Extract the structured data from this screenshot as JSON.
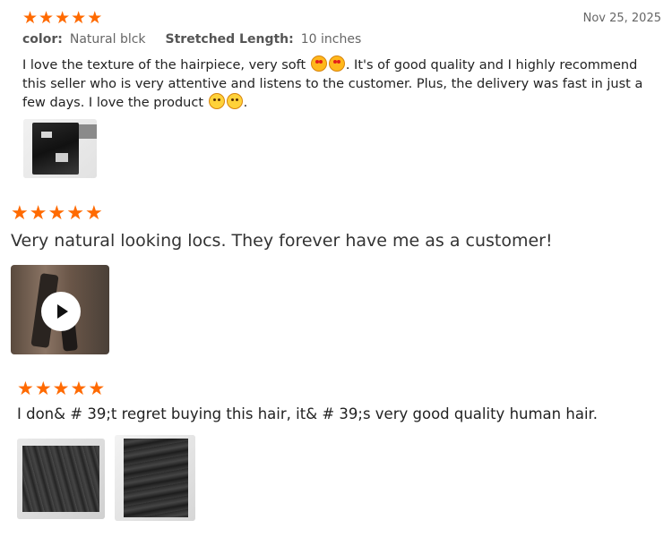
{
  "reviews": [
    {
      "rating": 5,
      "date": "Nov 25, 2025",
      "attributes": [
        {
          "key": "color",
          "value": "Natural blck"
        },
        {
          "key": "Stretched Length",
          "value": "10 inches"
        }
      ],
      "text_parts": [
        "I love the texture of the hairpiece, very soft",
        ". It's of good quality and I highly recommend this seller who is very attentive and listens to the customer. Plus, the delivery was fast in just a few days. I love the product",
        "."
      ],
      "emoji_1": "smiling-face-with-heart-eyes",
      "emoji_2": "smiling-face",
      "media": [
        {
          "type": "image"
        }
      ]
    },
    {
      "rating": 5,
      "text": "Very natural looking locs. They forever have me as a customer!",
      "media": [
        {
          "type": "video"
        }
      ]
    },
    {
      "rating": 5,
      "text": "I don& # 39;t regret buying this hair, it& # 39;s very good quality human hair.",
      "media": [
        {
          "type": "image"
        },
        {
          "type": "image"
        }
      ]
    }
  ],
  "star_glyph": "★",
  "accent_color": "#ff6a00"
}
